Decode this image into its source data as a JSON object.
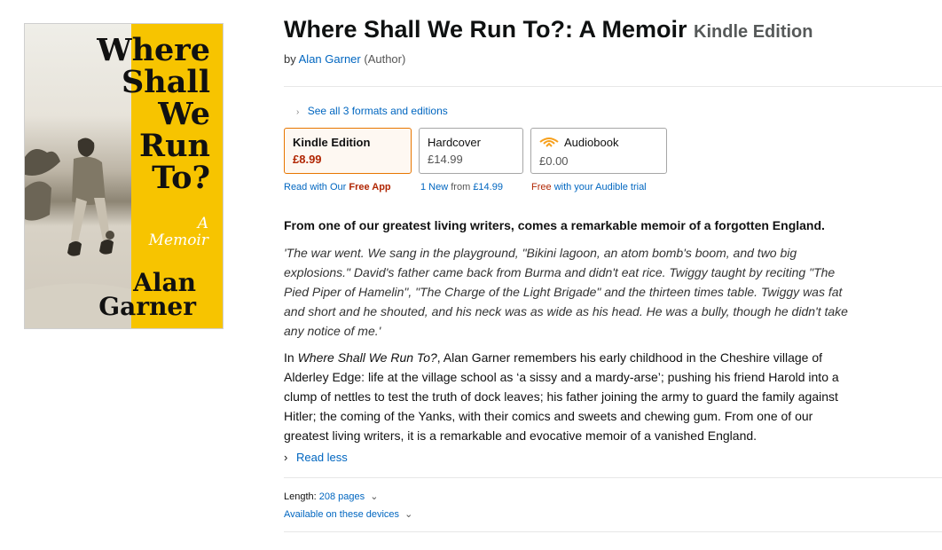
{
  "cover": {
    "title_lines": [
      "Where",
      "Shall",
      "We",
      "Run",
      "To?"
    ],
    "subtitle_lines": [
      "A",
      "Memoir"
    ],
    "author_lines": [
      "Alan",
      "Garner"
    ]
  },
  "product": {
    "title": "Where Shall We Run To?: A Memoir",
    "edition": "Kindle Edition",
    "by_prefix": "by",
    "author": "Alan Garner",
    "author_role": "(Author)"
  },
  "formats": {
    "see_all": "See all 3 formats and editions",
    "options": [
      {
        "name": "Kindle Edition",
        "price": "£8.99",
        "selected": true
      },
      {
        "name": "Hardcover",
        "price": "£14.99",
        "selected": false
      },
      {
        "name": "Audiobook",
        "price": "£0.00",
        "selected": false
      }
    ],
    "kindle_note_prefix": "Read with Our",
    "kindle_note_link": "Free App",
    "hardcover_note_link": "1 New",
    "hardcover_note_from": "from",
    "hardcover_note_price": "£14.99",
    "audio_note_free": "Free",
    "audio_note_rest": "with your Audible trial"
  },
  "description": {
    "lead": "From one of our greatest living writers, comes a remarkable memoir of a forgotten England.",
    "quote": "'The war went. We sang in the playground, \"Bikini lagoon, an atom bomb's boom, and two big explosions.\" David's father came back from Burma and didn't eat rice. Twiggy taught by reciting \"The Pied Piper of Hamelin\", \"The Charge of the Light Brigade\" and the thirteen times table. Twiggy was fat and short and he shouted, and his neck was as wide as his head. He was a bully, though he didn't take any notice of me.'",
    "body_prefix": "In",
    "body_title": "Where Shall We Run To?",
    "body_rest": ", Alan Garner remembers his early childhood in the Cheshire village of Alderley Edge: life at the village school as ‘a sissy and a mardy-arse’; pushing his friend Harold into a clump of nettles to test the truth of dock leaves; his father joining the army to guard the family against Hitler; the coming of the Yanks, with their comics and sweets and chewing gum. From one of our greatest living writers, it is a remarkable and evocative memoir of a vanished England.",
    "read_less": "Read less"
  },
  "details": {
    "length_label": "Length:",
    "length_value": "208 pages",
    "devices": "Available on these devices"
  },
  "colors": {
    "link": "#0066c0",
    "price_red": "#b12704",
    "selected_border": "#e77600",
    "cover_yellow": "#f7c400",
    "audible_orange": "#f7a01c"
  },
  "icons": [
    "chevron-right-icon",
    "audible-icon",
    "chevron-down-icon"
  ]
}
